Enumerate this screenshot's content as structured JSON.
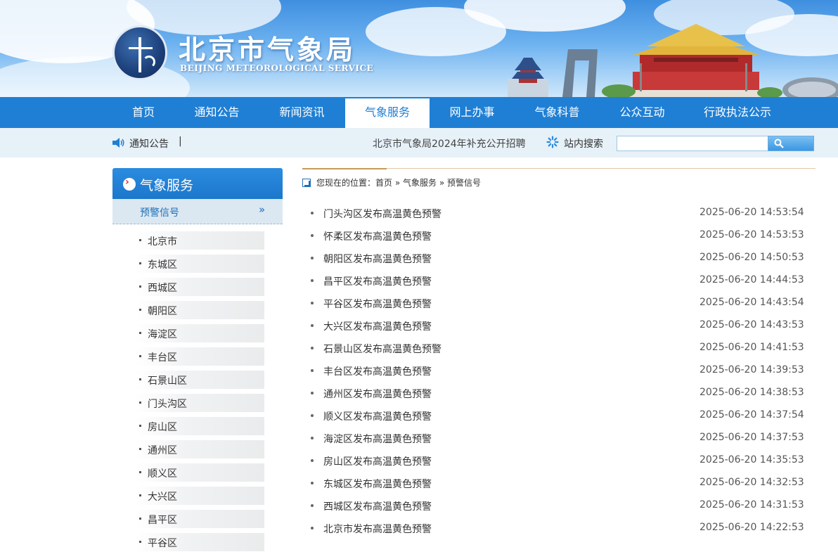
{
  "header": {
    "logo_cn": "北京市气象局",
    "logo_en": "BEIJING METEOROLOGICAL SERVICE"
  },
  "nav": {
    "items": [
      {
        "label": "首页"
      },
      {
        "label": "通知公告"
      },
      {
        "label": "新闻资讯"
      },
      {
        "label": "气象服务",
        "active": true
      },
      {
        "label": "网上办事"
      },
      {
        "label": "气象科普"
      },
      {
        "label": "公众互动"
      },
      {
        "label": "行政执法公示"
      }
    ]
  },
  "notice": {
    "label": "通知公告",
    "separator": "|",
    "headline": "北京市气象局2024年补充公开招聘",
    "search_label": "站内搜索",
    "search_value": ""
  },
  "sidebar": {
    "title": "气象服务",
    "current": "预警信号",
    "current_chevron": "»",
    "items": [
      {
        "label": "北京市"
      },
      {
        "label": "东城区"
      },
      {
        "label": "西城区"
      },
      {
        "label": "朝阳区"
      },
      {
        "label": "海淀区"
      },
      {
        "label": "丰台区"
      },
      {
        "label": "石景山区"
      },
      {
        "label": "门头沟区"
      },
      {
        "label": "房山区"
      },
      {
        "label": "通州区"
      },
      {
        "label": "顺义区"
      },
      {
        "label": "大兴区"
      },
      {
        "label": "昌平区"
      },
      {
        "label": "平谷区"
      }
    ]
  },
  "breadcrumb": {
    "prefix": "您现在的位置：",
    "home": "首页",
    "sep": " » ",
    "section": "气象服务",
    "current": "预警信号"
  },
  "warnings": [
    {
      "title": "门头沟区发布高温黄色预警",
      "time": "2025-06-20 14:53:54"
    },
    {
      "title": "怀柔区发布高温黄色预警",
      "time": "2025-06-20 14:53:53"
    },
    {
      "title": "朝阳区发布高温黄色预警",
      "time": "2025-06-20 14:50:53"
    },
    {
      "title": "昌平区发布高温黄色预警",
      "time": "2025-06-20 14:44:53"
    },
    {
      "title": "平谷区发布高温黄色预警",
      "time": "2025-06-20 14:43:54"
    },
    {
      "title": "大兴区发布高温黄色预警",
      "time": "2025-06-20 14:43:53"
    },
    {
      "title": "石景山区发布高温黄色预警",
      "time": "2025-06-20 14:41:53"
    },
    {
      "title": "丰台区发布高温黄色预警",
      "time": "2025-06-20 14:39:53"
    },
    {
      "title": "通州区发布高温黄色预警",
      "time": "2025-06-20 14:38:53"
    },
    {
      "title": "顺义区发布高温黄色预警",
      "time": "2025-06-20 14:37:54"
    },
    {
      "title": "海淀区发布高温黄色预警",
      "time": "2025-06-20 14:37:53"
    },
    {
      "title": "房山区发布高温黄色预警",
      "time": "2025-06-20 14:35:53"
    },
    {
      "title": "东城区发布高温黄色预警",
      "time": "2025-06-20 14:32:53"
    },
    {
      "title": "西城区发布高温黄色预警",
      "time": "2025-06-20 14:31:53"
    },
    {
      "title": "北京市发布高温黄色预警",
      "time": "2025-06-20 14:22:53"
    }
  ],
  "colors": {
    "nav_blue": "#1f7fd4",
    "notice_bg": "#e7f1f8",
    "link_blue": "#1f6fb8"
  }
}
